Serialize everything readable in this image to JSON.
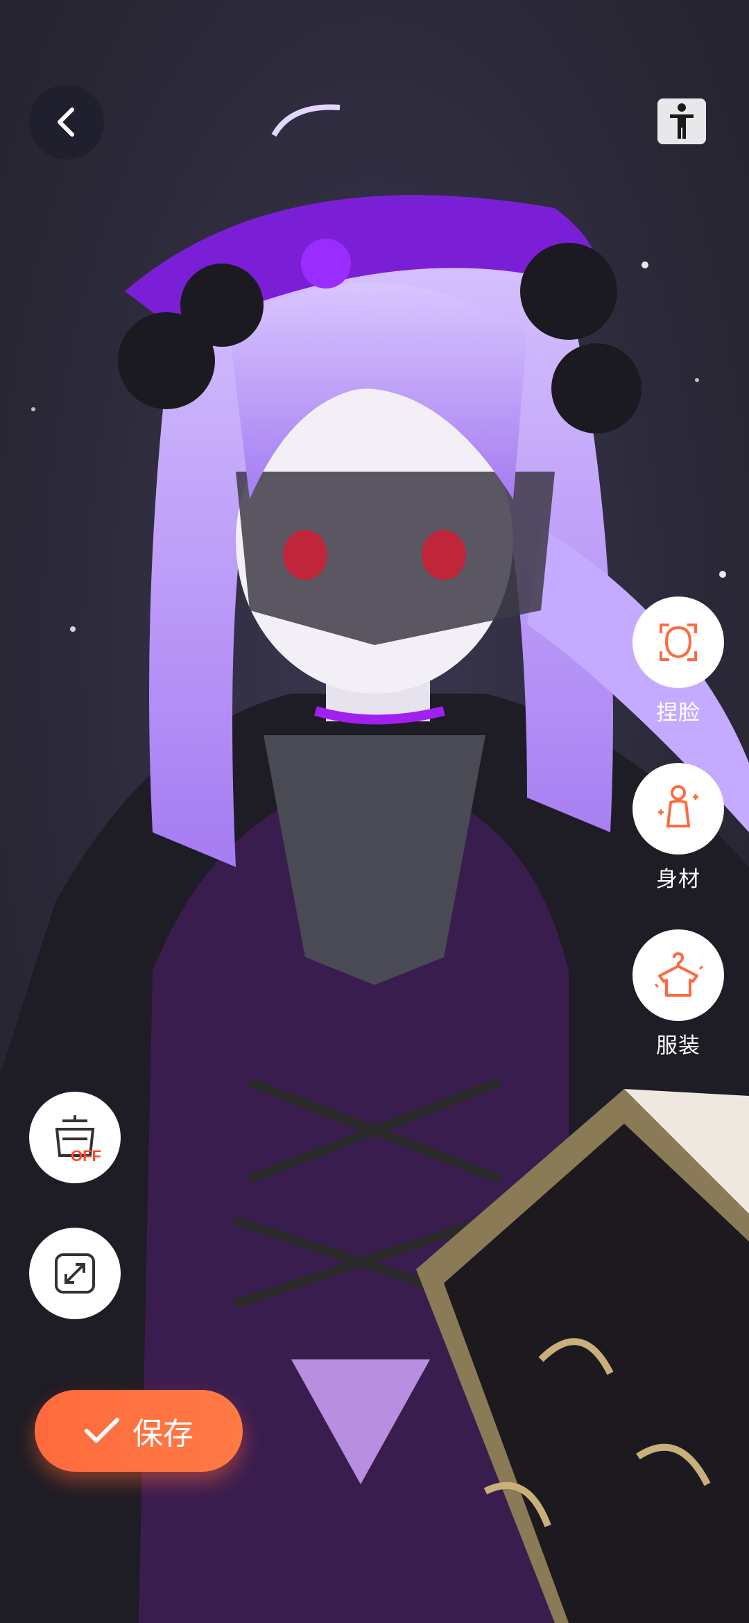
{
  "tools": [
    {
      "label": "捏脸",
      "icon": "face-sculpt-icon"
    },
    {
      "label": "身材",
      "icon": "body-shape-icon"
    },
    {
      "label": "服装",
      "icon": "outfit-hanger-icon"
    }
  ],
  "left_controls": {
    "toggle_badge": "OFF"
  },
  "save_label": "保存",
  "colors": {
    "accent": "#ff6a3d",
    "background": "#2b2a3a"
  }
}
